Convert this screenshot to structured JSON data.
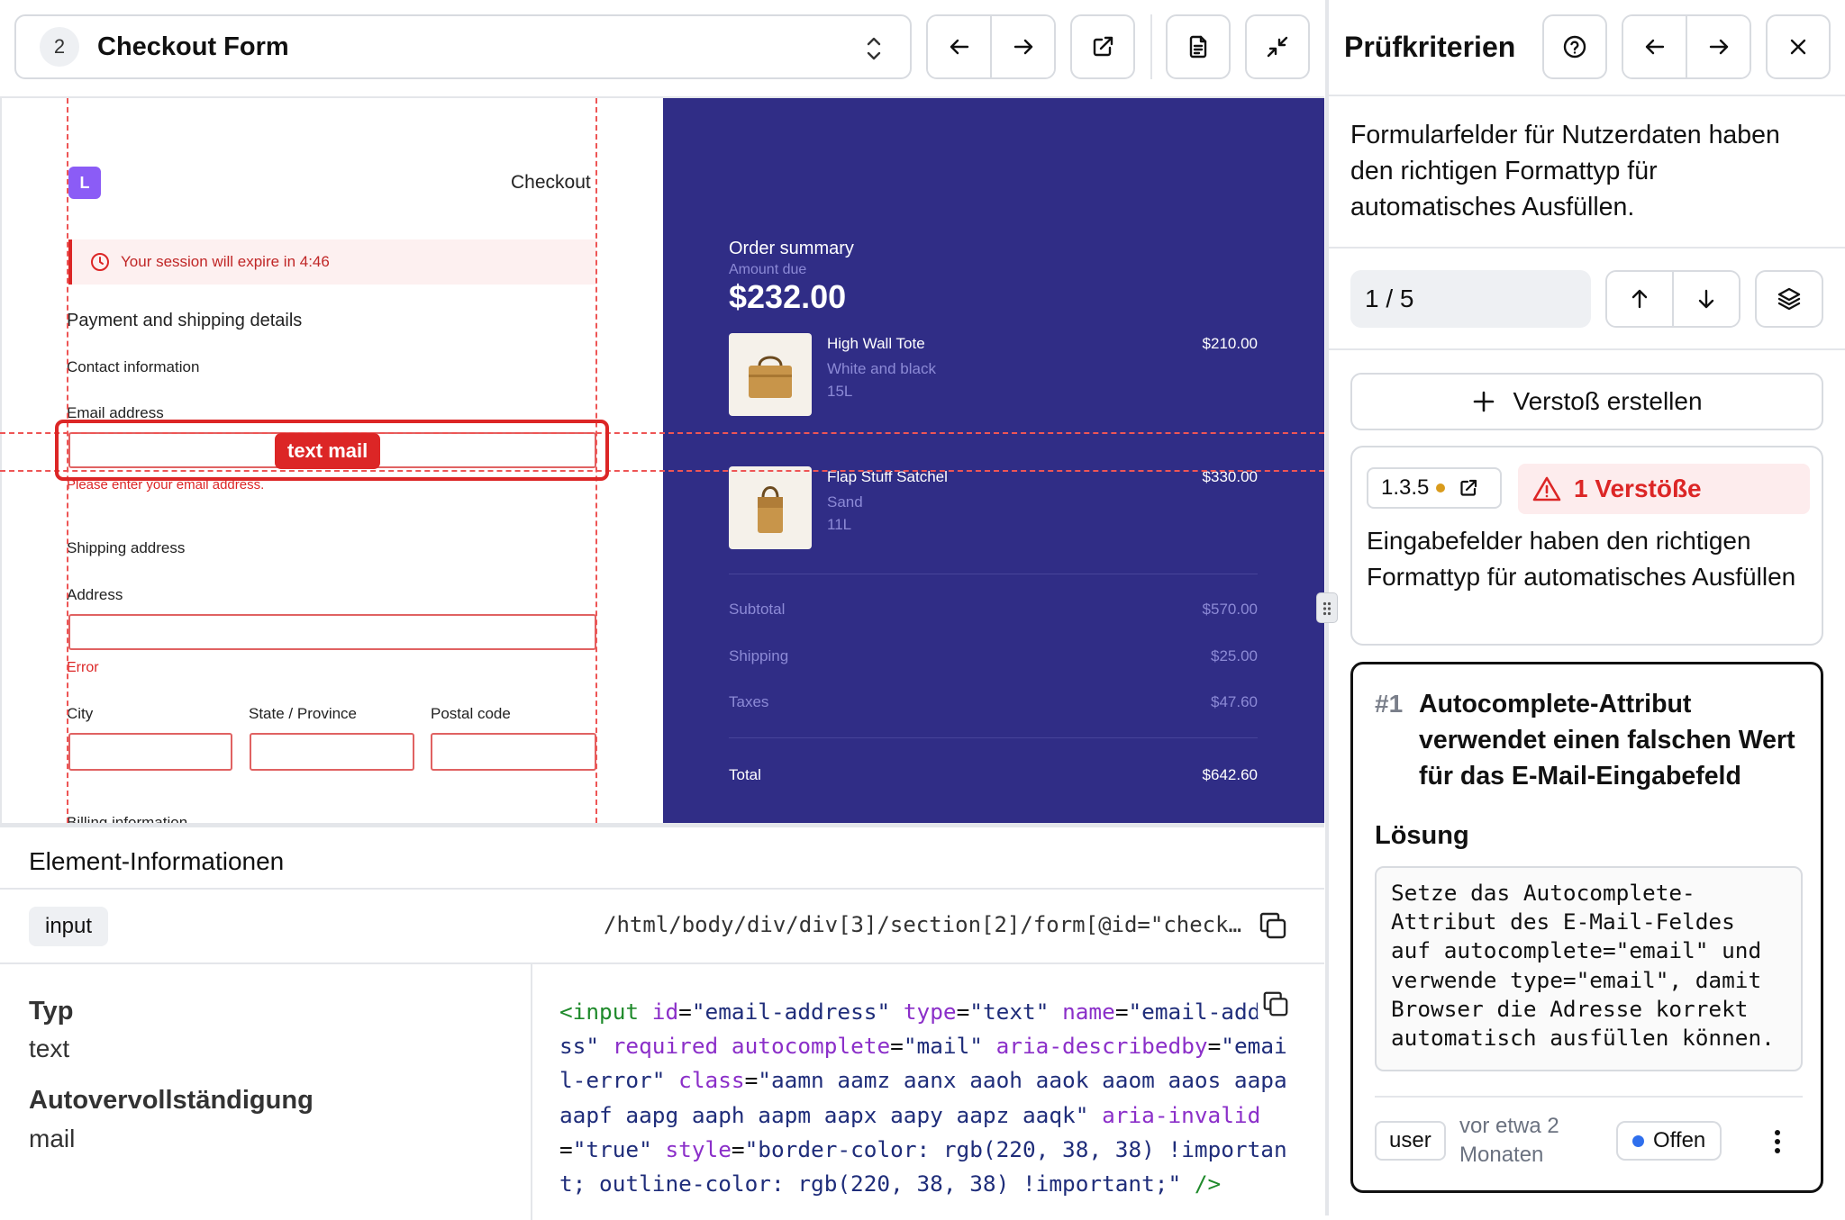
{
  "toolbar": {
    "step_number": "2",
    "page_name": "Checkout Form"
  },
  "preview": {
    "logo_letter": "L",
    "checkout_label": "Checkout",
    "session_notice": "Your session will expire in 4:46",
    "section_title": "Payment and shipping details",
    "contact_info": "Contact information",
    "email_label": "Email address",
    "highlight_badge": "text mail",
    "email_error": "Please enter your email address.",
    "shipping_address": "Shipping address",
    "address_label": "Address",
    "address_error": "Error",
    "city_label": "City",
    "state_label": "State / Province",
    "postal_label": "Postal code",
    "billing_partial": "Billing information",
    "order": {
      "title": "Order summary",
      "amount_due_label": "Amount due",
      "amount_due": "$232.00",
      "items": [
        {
          "name": "High Wall Tote",
          "variant": "White and black",
          "size": "15L",
          "price": "$210.00"
        },
        {
          "name": "Flap Stuff Satchel",
          "variant": "Sand",
          "size": "11L",
          "price": "$330.00"
        }
      ],
      "subtotal_label": "Subtotal",
      "subtotal": "$570.00",
      "shipping_label": "Shipping",
      "shipping": "$25.00",
      "taxes_label": "Taxes",
      "taxes": "$47.60",
      "total_label": "Total",
      "total": "$642.60"
    }
  },
  "element_info": {
    "title": "Element-Informationen",
    "tag": "input",
    "xpath": "/html/body/div/div[3]/section[2]/form[@id=\"check…",
    "props": [
      {
        "key": "Typ",
        "value": "text"
      },
      {
        "key": "Autovervollständigung",
        "value": "mail"
      }
    ],
    "code": {
      "t1": "<input",
      "a1": "id",
      "v1": "\"email-address\"",
      "a2": "type",
      "v2": "\"text\"",
      "a3": "name",
      "v3": "\"email-address\"",
      "a4": "required",
      "a5": "autocomplete",
      "v5": "\"mail\"",
      "a6": "aria-describedby",
      "v6": "\"email-error\"",
      "a7": "class",
      "v7": "\"aamn aamz aanx aaoh aaok aaom aaos aapa aapf aapg aaph aapm aapx aapy aapz aaqk\"",
      "a8": "aria-invalid",
      "v8": "\"true\"",
      "a9": "style",
      "v9": "\"border-color: rgb(220, 38, 38) !important; outline-color: rgb(220, 38, 38) !important;\"",
      "t2": "/>"
    }
  },
  "panel": {
    "title": "Prüfkriterien",
    "criterion_text": "Formularfelder für Nutzerdaten haben den richtigen Formattyp für automatisches Ausfüllen.",
    "counter": "1 / 5",
    "create_violation": "Verstoß erstellen",
    "rule": {
      "sc": "1.3.5",
      "violations": "1 Verstöße",
      "description": "Eingabefelder haben den richtigen Formattyp für automatisches Ausfüllen"
    },
    "issue": {
      "number": "#1",
      "title": "Autocomplete-Attribut verwendet einen falschen Wert für das E-Mail-Eingabefeld",
      "solution_label": "Lösung",
      "solution": "Setze das Autocomplete-Attribut des E-Mail-Feldes auf autocomplete=\"email\" und verwende type=\"email\", damit Browser die Adresse korrekt automatisch ausfüllen können.",
      "user": "user",
      "time": "vor etwa 2 Monaten",
      "status": "Offen"
    }
  },
  "colors": {
    "accent_red": "#dc2626",
    "summary_bg": "#302d86",
    "status_dot": "#2f6fed",
    "sc_dot": "#d99b1c"
  }
}
